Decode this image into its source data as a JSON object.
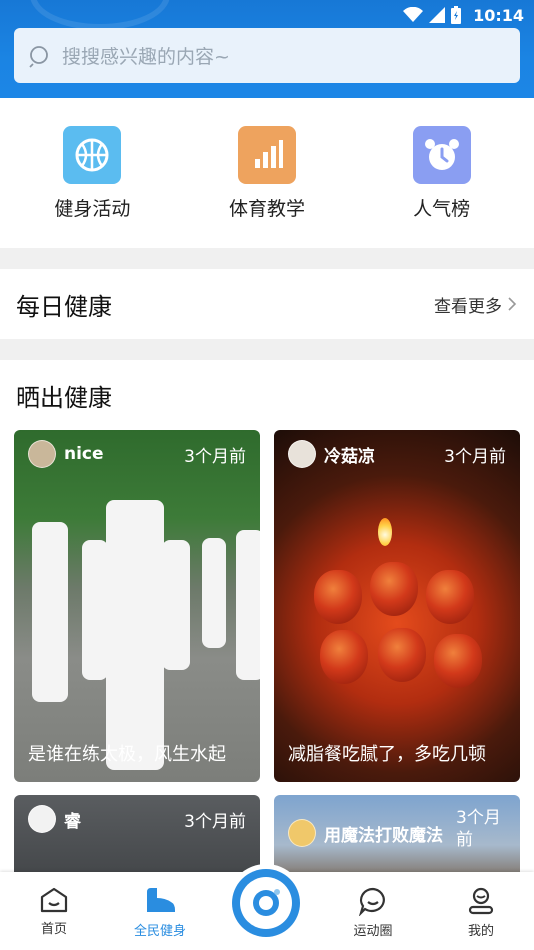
{
  "status_bar": {
    "time": "10:14"
  },
  "search": {
    "placeholder": "搜搜感兴趣的内容~"
  },
  "categories": [
    {
      "label": "健身活动",
      "icon": "basketball-icon",
      "color": "#5bbcf0"
    },
    {
      "label": "体育教学",
      "icon": "bar-chart-icon",
      "color": "#eea35e"
    },
    {
      "label": "人气榜",
      "icon": "alarm-clock-icon",
      "color": "#8a9ef2"
    }
  ],
  "daily_health": {
    "title": "每日健康",
    "more_label": "查看更多"
  },
  "share_health": {
    "title": "晒出健康",
    "cards": [
      {
        "user": "nice",
        "time": "3个月前",
        "caption": "是谁在练太极，风生水起"
      },
      {
        "user": "冷菇凉",
        "time": "3个月前",
        "caption": "减脂餐吃腻了，多吃几顿"
      },
      {
        "user": "睿",
        "time": "3个月前",
        "caption": ""
      },
      {
        "user": "用魔法打败魔法",
        "time": "3个月前",
        "caption": ""
      }
    ]
  },
  "tabbar": {
    "items": [
      {
        "label": "首页"
      },
      {
        "label": "全民健身"
      },
      {
        "label": ""
      },
      {
        "label": "运动圈"
      },
      {
        "label": "我的"
      }
    ],
    "active_color": "#2a8de0"
  },
  "colors": {
    "header": "#1b84e3",
    "accent": "#2a8de0"
  }
}
